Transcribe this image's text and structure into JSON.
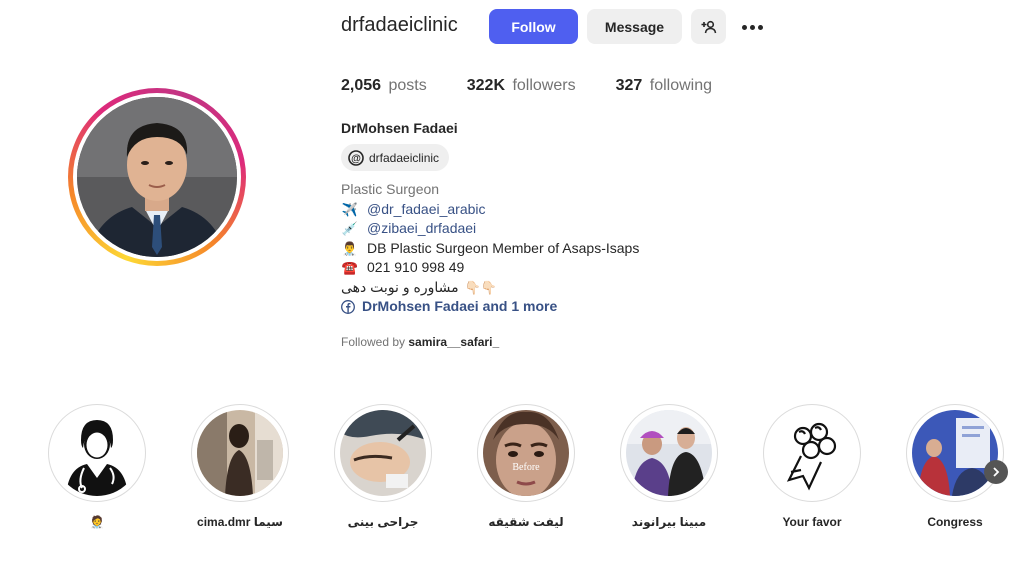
{
  "profile": {
    "username": "drfadaeiclinic",
    "follow_label": "Follow",
    "message_label": "Message",
    "posts_count": "2,056",
    "posts_label": "posts",
    "followers_count": "322K",
    "followers_label": "followers",
    "following_count": "327",
    "following_label": "following",
    "full_name": "DrMohsen Fadaei",
    "threads_handle": "drfadaeiclinic",
    "category": "Plastic Surgeon",
    "bio": {
      "line1_emoji": "✈️",
      "line1_link": "@dr_fadaei_arabic",
      "line2_emoji": "💉",
      "line2_link": "@zibaei_drfadaei",
      "line3_emoji": "👨‍⚕️",
      "line3_text": "DB Plastic Surgeon Member of Asaps-Isaps",
      "line4_emoji": "☎️",
      "line4_text": "021 910 998 49",
      "line5_text": "مشاوره و نوبت دهی",
      "line5_emoji": "👇🏻👇🏻",
      "fb_text": "DrMohsen Fadaei and 1 more"
    },
    "followed_by_prefix": "Followed by",
    "followed_by_user": "samira__safari_"
  },
  "highlights": [
    {
      "label": "🧑‍⚕️",
      "icon": "doctor-icon"
    },
    {
      "label": "cima.dmr سیما"
    },
    {
      "label": "جراحی بینی"
    },
    {
      "label": "لیفت شقیقه",
      "overlay_text": "Before"
    },
    {
      "label": "مبینا بیرانوند"
    },
    {
      "label": "Your favor",
      "icon": "flower-bouquet-icon"
    },
    {
      "label": "Congress"
    }
  ],
  "colors": {
    "follow_button": "#4f5ff0",
    "link": "#385185",
    "muted": "#737373"
  }
}
